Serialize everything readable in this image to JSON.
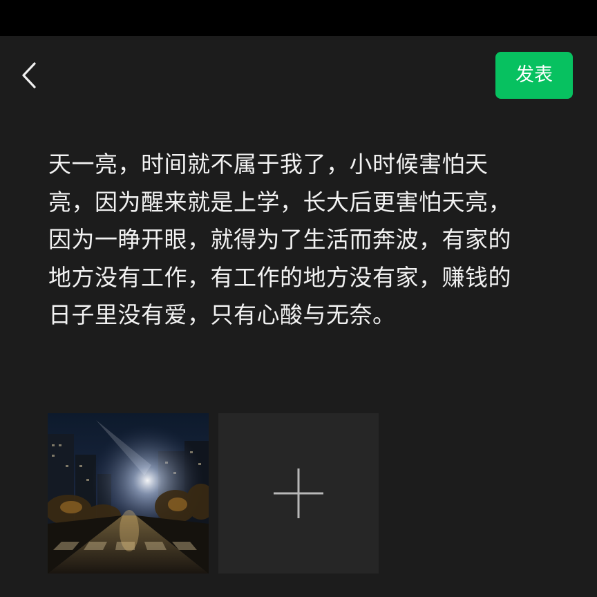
{
  "header": {
    "back_icon": "chevron-left-icon",
    "publish_label": "发表",
    "publish_color": "#07c160"
  },
  "post": {
    "text": "天一亮，时间就不属于我了，小时候害怕天亮，因为醒来就是上学，长大后更害怕天亮，因为一睁开眼，就得为了生活而奔波，有家的地方没有工作，有工作的地方没有家，赚钱的日子里没有爱，只有心酸与无奈。"
  },
  "attachments": {
    "photos": [
      {
        "description_icon": "night-street-photo"
      }
    ],
    "add_icon": "plus-icon"
  },
  "colors": {
    "background": "#1c1c1c",
    "status_bar": "#000000",
    "text": "#f2f2f2",
    "add_tile": "#262626"
  }
}
